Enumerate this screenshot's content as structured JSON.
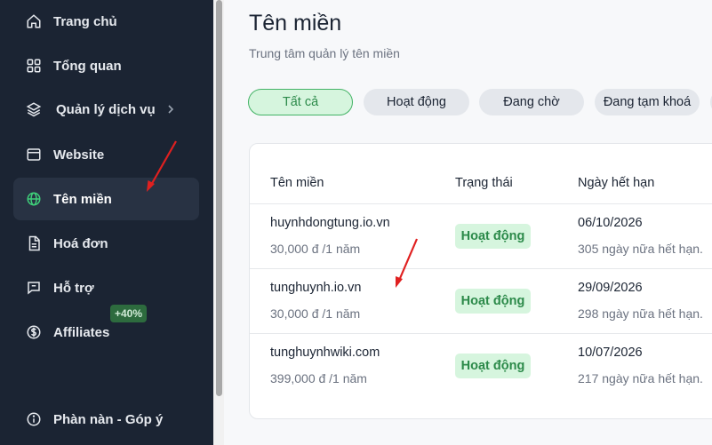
{
  "sidebar": {
    "items": [
      {
        "label": "Trang chủ",
        "icon": "home-icon"
      },
      {
        "label": "Tổng quan",
        "icon": "grid-icon"
      },
      {
        "label": "Quản lý dịch vụ",
        "icon": "layers-icon"
      },
      {
        "label": "Website",
        "icon": "browser-icon"
      },
      {
        "label": "Tên miền",
        "icon": "globe-icon"
      },
      {
        "label": "Hoá đơn",
        "icon": "invoice-icon"
      },
      {
        "label": "Hỗ trợ",
        "icon": "chat-icon"
      },
      {
        "label": "Affiliates",
        "icon": "dollar-icon",
        "badge": "+40%"
      }
    ],
    "footer": {
      "label": "Phàn nàn - Góp ý",
      "icon": "info-icon"
    }
  },
  "page": {
    "title": "Tên miền",
    "subtitle": "Trung tâm quản lý tên miền"
  },
  "filters": [
    "Tất cả",
    "Hoạt động",
    "Đang chờ",
    "Đang tạm khoá"
  ],
  "table": {
    "headers": [
      "Tên miền",
      "Trạng thái",
      "Ngày hết hạn"
    ],
    "rows": [
      {
        "domain": "huynhdongtung.io.vn",
        "price": "30,000 đ /1 năm",
        "status": "Hoạt động",
        "expiry": "06/10/2026",
        "note": "305 ngày nữa hết hạn."
      },
      {
        "domain": "tunghuynh.io.vn",
        "price": "30,000 đ /1 năm",
        "status": "Hoạt động",
        "expiry": "29/09/2026",
        "note": "298 ngày nữa hết hạn."
      },
      {
        "domain": "tunghuynhwiki.com",
        "price": "399,000 đ /1 năm",
        "status": "Hoạt động",
        "expiry": "10/07/2026",
        "note": "217 ngày nữa hết hạn."
      }
    ]
  },
  "colors": {
    "sidebar_bg": "#1b2433",
    "accent_green": "#2c8a4a",
    "annotation_red": "#e02020"
  }
}
